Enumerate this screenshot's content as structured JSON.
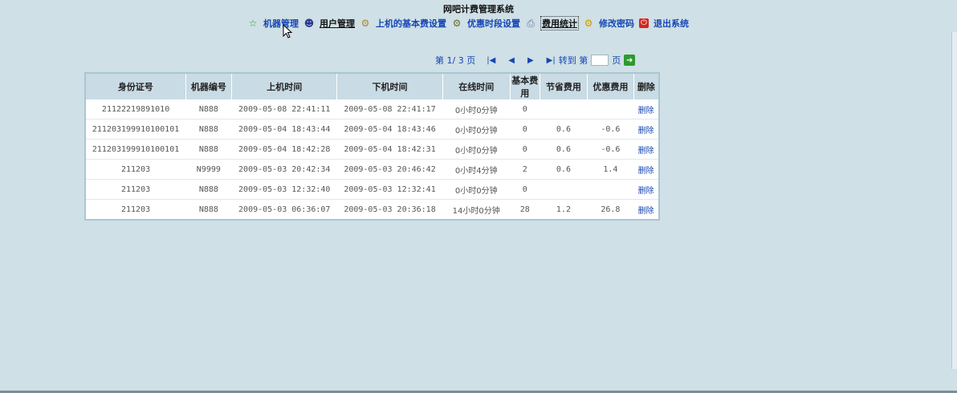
{
  "app_title": "网吧计费管理系统",
  "nav": [
    {
      "icon": "star-icon",
      "label": "机器管理"
    },
    {
      "icon": "user-icon",
      "label": "用户管理"
    },
    {
      "icon": "gear-icon",
      "label": "上机的基本费设置"
    },
    {
      "icon": "gear-icon",
      "label": "优惠时段设置"
    },
    {
      "icon": "printer-icon",
      "label": "费用统计"
    },
    {
      "icon": "key-icon",
      "label": "修改密码"
    },
    {
      "icon": "power-icon",
      "label": "退出系统"
    }
  ],
  "pager": {
    "page_text": "第 1/ 3 页",
    "goto_label": "转到 第",
    "page_suffix": "页",
    "page_input_value": ""
  },
  "table": {
    "headers": [
      "身份证号",
      "机器编号",
      "上机时间",
      "下机时间",
      "在线时间",
      "基本费用",
      "节省费用",
      "优惠费用",
      "删除"
    ],
    "rows": [
      [
        "21122219891010",
        "N888",
        "2009-05-08 22:41:11",
        "2009-05-08 22:41:17",
        "0小时0分钟",
        "0",
        "",
        "",
        "删除"
      ],
      [
        "211203199910100101",
        "N888",
        "2009-05-04 18:43:44",
        "2009-05-04 18:43:46",
        "0小时0分钟",
        "0",
        "0.6",
        "-0.6",
        "删除"
      ],
      [
        "211203199910100101",
        "N888",
        "2009-05-04 18:42:28",
        "2009-05-04 18:42:31",
        "0小时0分钟",
        "0",
        "0.6",
        "-0.6",
        "删除"
      ],
      [
        "211203",
        "N9999",
        "2009-05-03 20:42:34",
        "2009-05-03 20:46:42",
        "0小时4分钟",
        "2",
        "0.6",
        "1.4",
        "删除"
      ],
      [
        "211203",
        "N888",
        "2009-05-03 12:32:40",
        "2009-05-03 12:32:41",
        "0小时0分钟",
        "0",
        "",
        "",
        "删除"
      ],
      [
        "211203",
        "N888",
        "2009-05-03 06:36:07",
        "2009-05-03 20:36:18",
        "14小时0分钟",
        "28",
        "1.2",
        "26.8",
        "删除"
      ]
    ]
  },
  "colors": {
    "background": "#cfe0e6",
    "link": "#1546b5",
    "header_bg": "#c9dbe4"
  }
}
